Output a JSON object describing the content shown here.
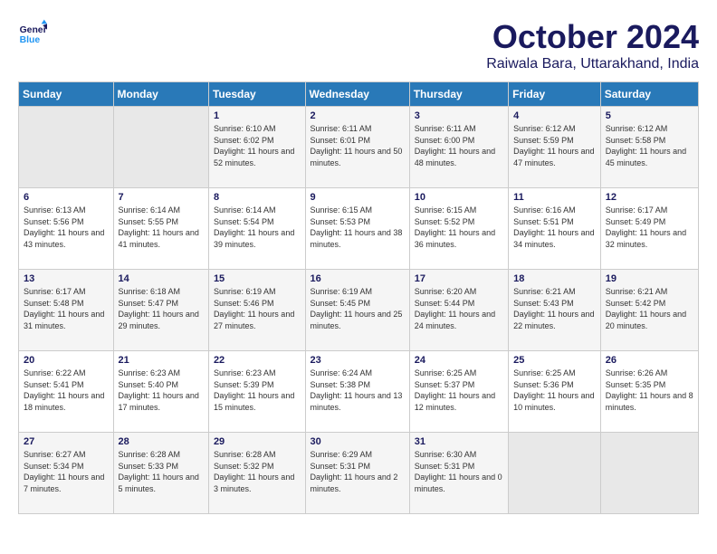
{
  "header": {
    "logo_line1": "General",
    "logo_line2": "Blue",
    "month": "October 2024",
    "location": "Raiwala Bara, Uttarakhand, India"
  },
  "days_of_week": [
    "Sunday",
    "Monday",
    "Tuesday",
    "Wednesday",
    "Thursday",
    "Friday",
    "Saturday"
  ],
  "weeks": [
    [
      {
        "day": "",
        "info": ""
      },
      {
        "day": "",
        "info": ""
      },
      {
        "day": "1",
        "info": "Sunrise: 6:10 AM\nSunset: 6:02 PM\nDaylight: 11 hours and 52 minutes."
      },
      {
        "day": "2",
        "info": "Sunrise: 6:11 AM\nSunset: 6:01 PM\nDaylight: 11 hours and 50 minutes."
      },
      {
        "day": "3",
        "info": "Sunrise: 6:11 AM\nSunset: 6:00 PM\nDaylight: 11 hours and 48 minutes."
      },
      {
        "day": "4",
        "info": "Sunrise: 6:12 AM\nSunset: 5:59 PM\nDaylight: 11 hours and 47 minutes."
      },
      {
        "day": "5",
        "info": "Sunrise: 6:12 AM\nSunset: 5:58 PM\nDaylight: 11 hours and 45 minutes."
      }
    ],
    [
      {
        "day": "6",
        "info": "Sunrise: 6:13 AM\nSunset: 5:56 PM\nDaylight: 11 hours and 43 minutes."
      },
      {
        "day": "7",
        "info": "Sunrise: 6:14 AM\nSunset: 5:55 PM\nDaylight: 11 hours and 41 minutes."
      },
      {
        "day": "8",
        "info": "Sunrise: 6:14 AM\nSunset: 5:54 PM\nDaylight: 11 hours and 39 minutes."
      },
      {
        "day": "9",
        "info": "Sunrise: 6:15 AM\nSunset: 5:53 PM\nDaylight: 11 hours and 38 minutes."
      },
      {
        "day": "10",
        "info": "Sunrise: 6:15 AM\nSunset: 5:52 PM\nDaylight: 11 hours and 36 minutes."
      },
      {
        "day": "11",
        "info": "Sunrise: 6:16 AM\nSunset: 5:51 PM\nDaylight: 11 hours and 34 minutes."
      },
      {
        "day": "12",
        "info": "Sunrise: 6:17 AM\nSunset: 5:49 PM\nDaylight: 11 hours and 32 minutes."
      }
    ],
    [
      {
        "day": "13",
        "info": "Sunrise: 6:17 AM\nSunset: 5:48 PM\nDaylight: 11 hours and 31 minutes."
      },
      {
        "day": "14",
        "info": "Sunrise: 6:18 AM\nSunset: 5:47 PM\nDaylight: 11 hours and 29 minutes."
      },
      {
        "day": "15",
        "info": "Sunrise: 6:19 AM\nSunset: 5:46 PM\nDaylight: 11 hours and 27 minutes."
      },
      {
        "day": "16",
        "info": "Sunrise: 6:19 AM\nSunset: 5:45 PM\nDaylight: 11 hours and 25 minutes."
      },
      {
        "day": "17",
        "info": "Sunrise: 6:20 AM\nSunset: 5:44 PM\nDaylight: 11 hours and 24 minutes."
      },
      {
        "day": "18",
        "info": "Sunrise: 6:21 AM\nSunset: 5:43 PM\nDaylight: 11 hours and 22 minutes."
      },
      {
        "day": "19",
        "info": "Sunrise: 6:21 AM\nSunset: 5:42 PM\nDaylight: 11 hours and 20 minutes."
      }
    ],
    [
      {
        "day": "20",
        "info": "Sunrise: 6:22 AM\nSunset: 5:41 PM\nDaylight: 11 hours and 18 minutes."
      },
      {
        "day": "21",
        "info": "Sunrise: 6:23 AM\nSunset: 5:40 PM\nDaylight: 11 hours and 17 minutes."
      },
      {
        "day": "22",
        "info": "Sunrise: 6:23 AM\nSunset: 5:39 PM\nDaylight: 11 hours and 15 minutes."
      },
      {
        "day": "23",
        "info": "Sunrise: 6:24 AM\nSunset: 5:38 PM\nDaylight: 11 hours and 13 minutes."
      },
      {
        "day": "24",
        "info": "Sunrise: 6:25 AM\nSunset: 5:37 PM\nDaylight: 11 hours and 12 minutes."
      },
      {
        "day": "25",
        "info": "Sunrise: 6:25 AM\nSunset: 5:36 PM\nDaylight: 11 hours and 10 minutes."
      },
      {
        "day": "26",
        "info": "Sunrise: 6:26 AM\nSunset: 5:35 PM\nDaylight: 11 hours and 8 minutes."
      }
    ],
    [
      {
        "day": "27",
        "info": "Sunrise: 6:27 AM\nSunset: 5:34 PM\nDaylight: 11 hours and 7 minutes."
      },
      {
        "day": "28",
        "info": "Sunrise: 6:28 AM\nSunset: 5:33 PM\nDaylight: 11 hours and 5 minutes."
      },
      {
        "day": "29",
        "info": "Sunrise: 6:28 AM\nSunset: 5:32 PM\nDaylight: 11 hours and 3 minutes."
      },
      {
        "day": "30",
        "info": "Sunrise: 6:29 AM\nSunset: 5:31 PM\nDaylight: 11 hours and 2 minutes."
      },
      {
        "day": "31",
        "info": "Sunrise: 6:30 AM\nSunset: 5:31 PM\nDaylight: 11 hours and 0 minutes."
      },
      {
        "day": "",
        "info": ""
      },
      {
        "day": "",
        "info": ""
      }
    ]
  ]
}
